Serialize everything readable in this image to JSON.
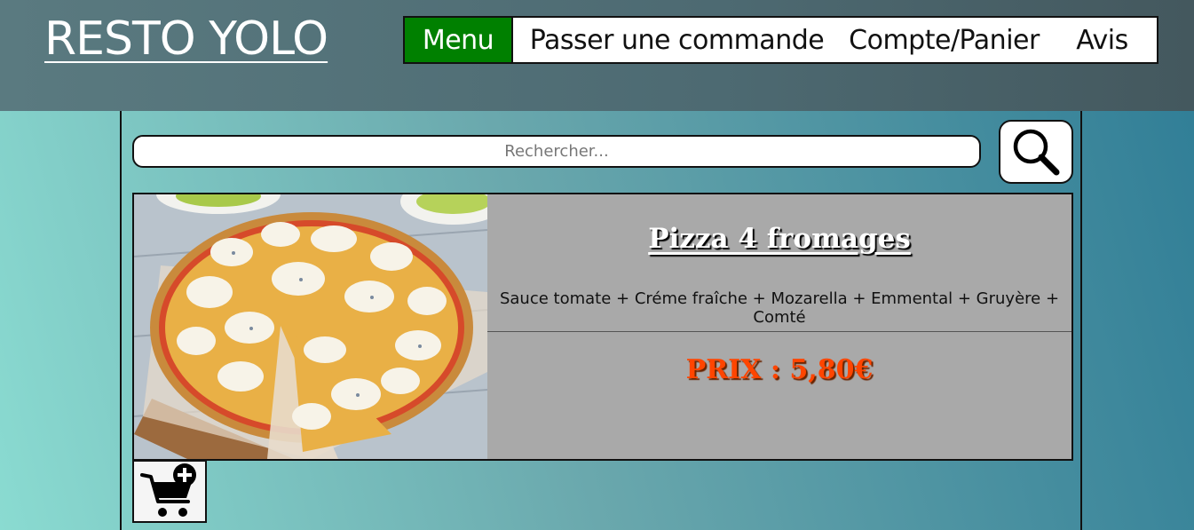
{
  "header": {
    "logo": "RESTO YOLO",
    "nav": [
      {
        "label": "Menu",
        "active": true
      },
      {
        "label": "Passer une commande",
        "active": false
      },
      {
        "label": "Compte/Panier",
        "active": false
      },
      {
        "label": "Avis",
        "active": false
      }
    ]
  },
  "search": {
    "placeholder": "Rechercher...",
    "value": "",
    "button_icon": "search-icon"
  },
  "products": [
    {
      "title": "Pizza 4 fromages",
      "description": "Sauce tomate + Créme fraîche + Mozarella + Emmental + Gruyère + Comté",
      "price": "PRIX : 5,80€",
      "image": "pizza-4-fromages-image",
      "add_to_cart_icon": "add-to-cart-icon"
    }
  ],
  "colors": {
    "nav_active": "#008000",
    "price": "#ff4500",
    "card_background": "#a9a9a9"
  }
}
